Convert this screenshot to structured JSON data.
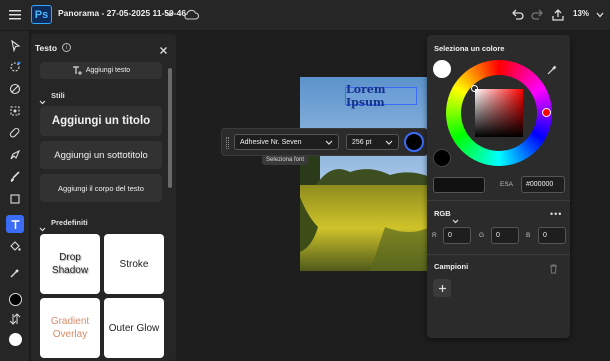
{
  "app": {
    "logo": "Ps",
    "document_title": "Panorama - 27-05-2025 11-50-46",
    "zoom": "13%"
  },
  "text_panel": {
    "title": "Testo",
    "add_text_label": "Aggiungi testo",
    "styles_section": "Stili",
    "add_heading": "Aggiungi un titolo",
    "add_subheading": "Aggiungi un sottotitolo",
    "add_body": "Aggiungi il corpo del testo",
    "presets_section": "Predefiniti",
    "presets": [
      {
        "label": "Drop Shadow"
      },
      {
        "label": "Stroke"
      },
      {
        "label": "Gradient Overlay"
      },
      {
        "label": "Outer Glow"
      }
    ]
  },
  "canvas": {
    "sample_text": "Lorem Ipsum"
  },
  "text_toolbar": {
    "font": "Adhesive Nr. Seven",
    "size": "256 pt",
    "tooltip": "Seleziona font"
  },
  "color_picker": {
    "title": "Seleziona un colore",
    "esa_label": "ESA",
    "hex_value": "#000000",
    "mode": "RGB",
    "r_label": "R",
    "g_label": "G",
    "b_label": "B",
    "r": "0",
    "g": "0",
    "b": "0",
    "swatches_title": "Campioni"
  },
  "colors": {
    "accent": "#3b6cf6",
    "text_color": "#000000"
  }
}
